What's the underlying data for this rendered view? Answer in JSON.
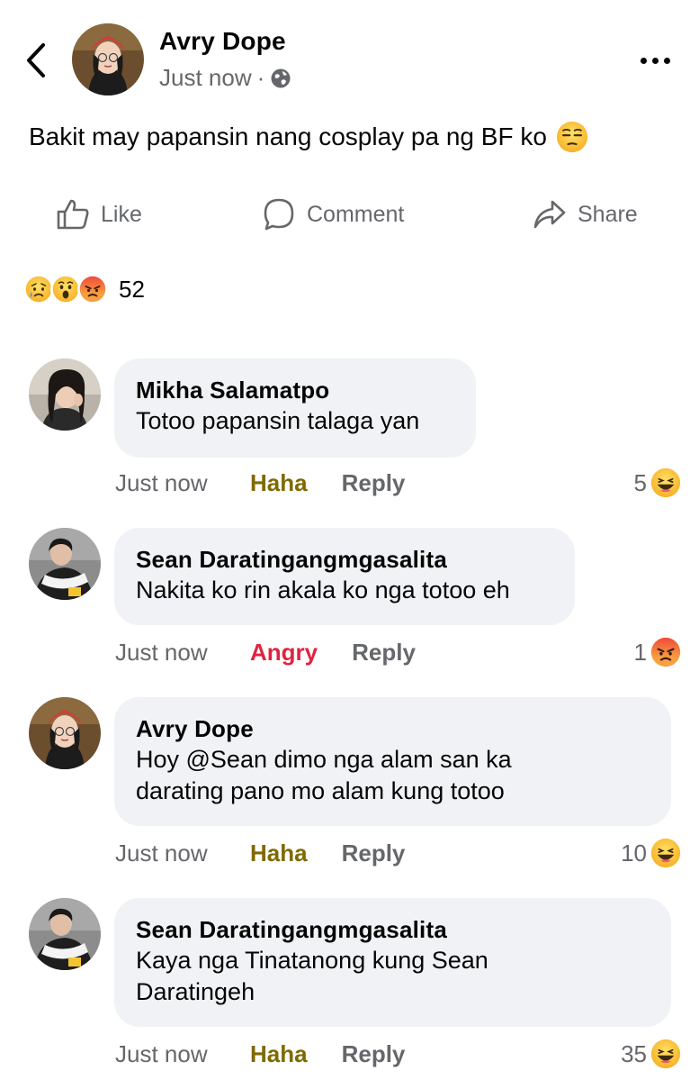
{
  "post": {
    "author": "Avry Dope",
    "time": "Just now",
    "separator": "·",
    "audience_icon": "globe-icon",
    "text": "Bakit may papansin nang cosplay pa ng BF ko",
    "text_emoji": "unamused-emoji"
  },
  "actions": {
    "like": "Like",
    "comment": "Comment",
    "share": "Share"
  },
  "reactions_summary": {
    "icons": [
      "sad-reaction",
      "wow-reaction",
      "angry-reaction"
    ],
    "count": "52"
  },
  "comments": [
    {
      "author": "Mikha Salamatpo",
      "text": "Totoo papansin talaga yan",
      "time": "Just now",
      "reaction_label": "Haha",
      "reaction_color": "#7f6a00",
      "reply": "Reply",
      "count": "5",
      "count_icon": "haha-reaction"
    },
    {
      "author": "Sean Daratingangmgasalita",
      "text": "Nakita ko rin akala ko nga totoo eh",
      "time": "Just now",
      "reaction_label": "Angry",
      "reaction_color": "#e0243f",
      "reply": "Reply",
      "count": "1",
      "count_icon": "angry-reaction"
    },
    {
      "author": "Avry Dope",
      "text": "Hoy @Sean dimo nga alam san ka\ndarating pano mo alam kung totoo",
      "time": "Just now",
      "reaction_label": "Haha",
      "reaction_color": "#7f6a00",
      "reply": "Reply",
      "count": "10",
      "count_icon": "haha-reaction"
    },
    {
      "author": "Sean Daratingangmgasalita",
      "text": "Kaya nga Tinatanong kung Sean\nDaratingeh",
      "time": "Just now",
      "reaction_label": "Haha",
      "reaction_color": "#7f6a00",
      "reply": "Reply",
      "count": "35",
      "count_icon": "haha-reaction"
    }
  ],
  "colors": {
    "bubble": "#f0f2f5",
    "muted": "#65676b",
    "haha": "#7f6a00",
    "angry": "#e0243f"
  }
}
